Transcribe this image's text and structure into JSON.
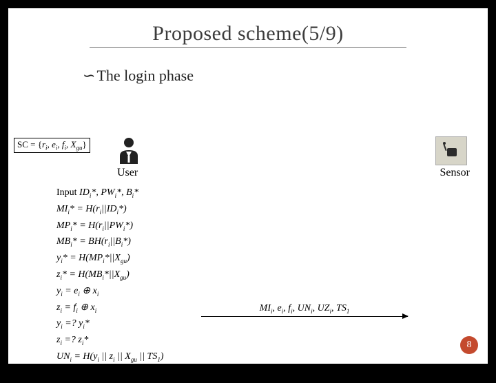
{
  "title": "Proposed scheme(5/9)",
  "subtitle": "The login phase",
  "sc_box_html": "SC = {<i>r<sub>i</sub></i>, <i>e<sub>i</sub></i>, <i>f<sub>i</sub></i>, <i>X<sub>gu</sub></i>}",
  "user_label": "User",
  "sensor_label": "Sensor",
  "formulas_html": "<span class='up'>Input</span> ID<sub>i</sub>*, PW<sub>i</sub>*, B<sub>i</sub>*<br>MI<sub>i</sub>* = H(r<sub>i</sub>||ID<sub>i</sub>*)<br>MP<sub>i</sub>* = H(r<sub>i</sub>||PW<sub>i</sub>*)<br>MB<sub>i</sub>* = BH(r<sub>i</sub>||B<sub>i</sub>*)<br>y<sub>i</sub>* = H(MP<sub>i</sub>*||X<sub>gu</sub>)<br>z<sub>i</sub>* = H(MB<sub>i</sub>*||X<sub>gu</sub>)<br>y<sub>i</sub> = e<sub>i</sub> ⊕ x<sub>i</sub><br>z<sub>i</sub> = f<sub>i</sub> ⊕ x<sub>i</sub><br>y<sub>i</sub> =? y<sub>i</sub>*<br>z<sub>i</sub> =? z<sub>i</sub>*<br>UN<sub>i</sub> = H(y<sub>i</sub> || z<sub>i</sub> || X<sub>gu</sub> || TS<sub>1</sub>)<br>UZ<sub>i</sub> = n ⊕ x<sub>i</sub>",
  "arrow_label_html": "MI<sub>i</sub>, e<sub>i</sub>, f<sub>i</sub>, UN<sub>i</sub>, UZ<sub>i</sub>, TS<sub>1</sub>",
  "page_number": "8"
}
